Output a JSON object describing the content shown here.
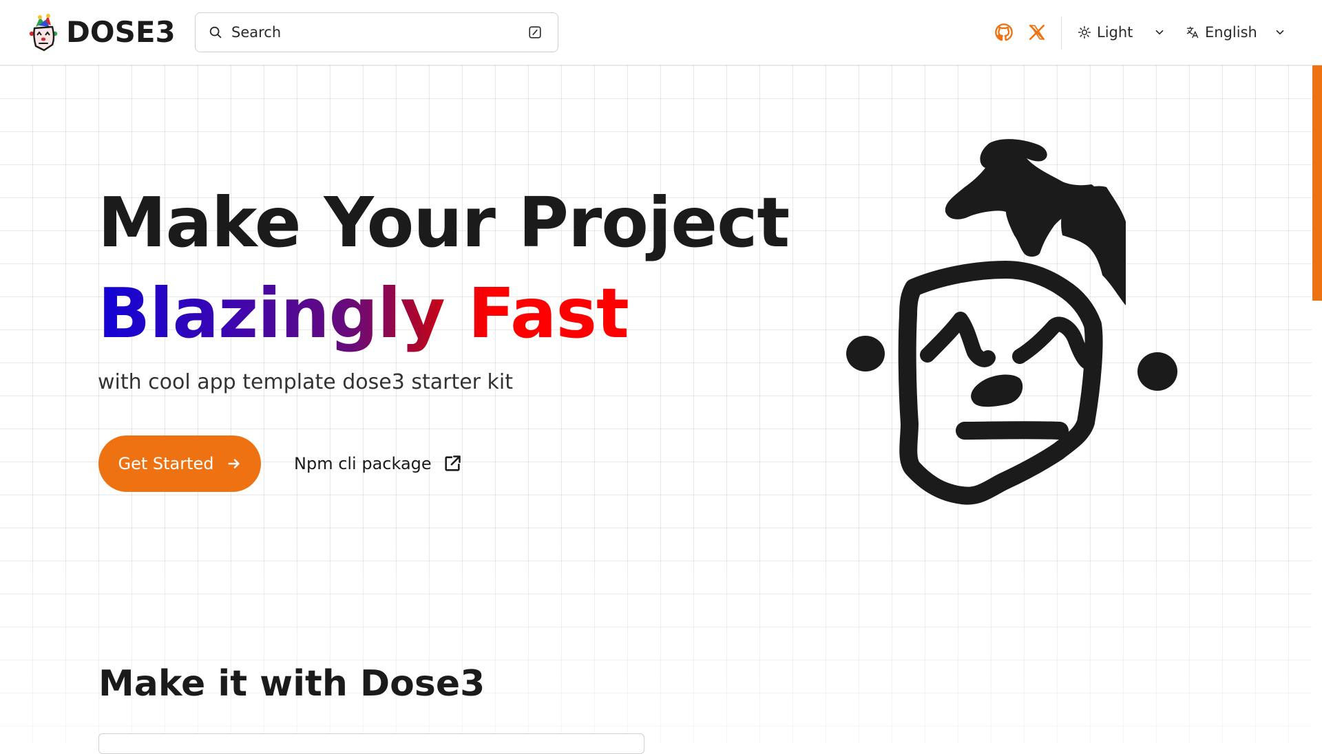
{
  "header": {
    "brand": "DOSE3",
    "search": {
      "placeholder": "Search"
    },
    "social": [
      {
        "name": "github-icon",
        "color": "#ee7211"
      },
      {
        "name": "x-icon",
        "color": "#ee7211"
      }
    ],
    "theme": {
      "selected": "Light",
      "icon": "sun-icon"
    },
    "language": {
      "selected": "English",
      "icon": "translate-icon"
    }
  },
  "hero": {
    "title_line1": "Make Your Project",
    "title_line2": "Blazingly Fast",
    "subtitle": "with cool app template dose3 starter kit",
    "primary_button": "Get Started",
    "secondary_link": "Npm cli package"
  },
  "section": {
    "title": "Make it with Dose3"
  },
  "colors": {
    "accent": "#ee7211",
    "gradient_start": "#1203d6",
    "gradient_end": "#ff0000",
    "text": "#1b1b1b"
  }
}
